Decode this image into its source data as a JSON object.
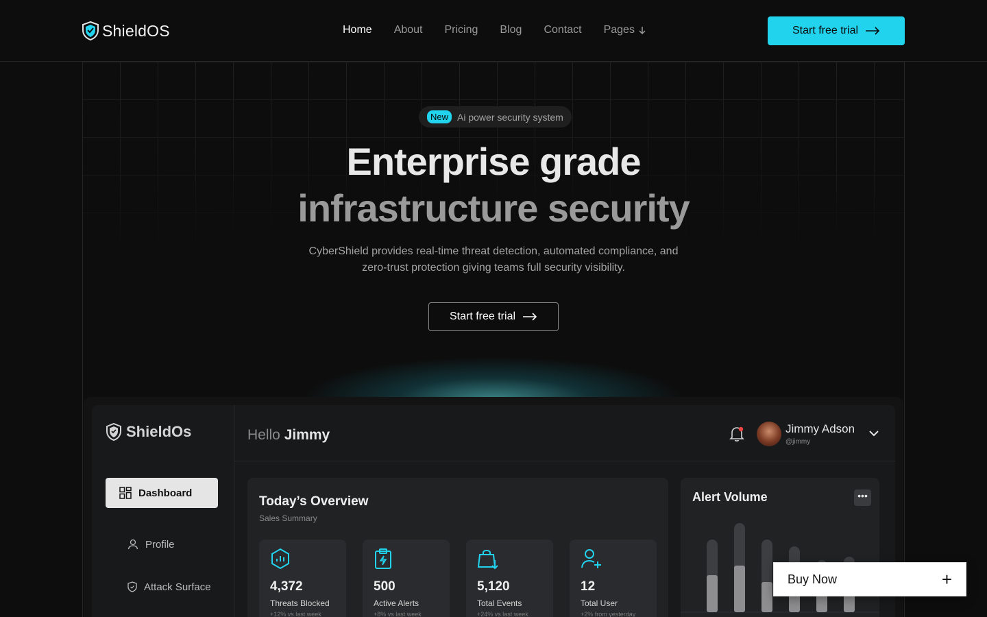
{
  "brand": {
    "name": "ShieldOS",
    "accent": "#22d3ee"
  },
  "nav": {
    "links": [
      "Home",
      "About",
      "Pricing",
      "Blog",
      "Contact",
      "Pages"
    ],
    "active": "Home",
    "cta": "Start free trial"
  },
  "hero": {
    "badge_new": "New",
    "badge_text": "Ai power security system",
    "title_line1": "Enterprise grade",
    "title_line2": "infrastructure security",
    "subtitle": "CyberShield provides real-time threat detection, automated compliance, and zero-trust protection giving teams full security visibility.",
    "cta": "Start free trial"
  },
  "dashboard": {
    "logo": "ShieldOs",
    "sidebar": [
      {
        "label": "Dashboard",
        "icon": "grid-icon",
        "active": true
      },
      {
        "label": "Profile",
        "icon": "user-icon",
        "active": false
      },
      {
        "label": "Attack Surface",
        "icon": "shield-icon",
        "active": false
      }
    ],
    "greeting": "Hello",
    "greeting_name": "Jimmy",
    "user": {
      "name": "Jimmy Adson",
      "handle": "@jimmy"
    },
    "overview": {
      "title": "Today’s Overview",
      "subtitle": "Sales Summary",
      "stats": [
        {
          "value": "4,372",
          "label": "Threats Blocked",
          "trend": "+12% vs last week",
          "icon": "hexagon-chart-icon"
        },
        {
          "value": "500",
          "label": "Active Alerts",
          "trend": "+8% vs last week",
          "icon": "clipboard-bolt-icon"
        },
        {
          "value": "5,120",
          "label": "Total Events",
          "trend": "+24% vs last week",
          "icon": "bag-download-icon"
        },
        {
          "value": "12",
          "label": "Total User",
          "trend": "+2% from yesterday",
          "icon": "user-add-icon"
        }
      ]
    },
    "alert_volume": {
      "title": "Alert Volume",
      "more": "•••"
    }
  },
  "buy_now": {
    "label": "Buy Now",
    "icon": "plus-icon"
  }
}
